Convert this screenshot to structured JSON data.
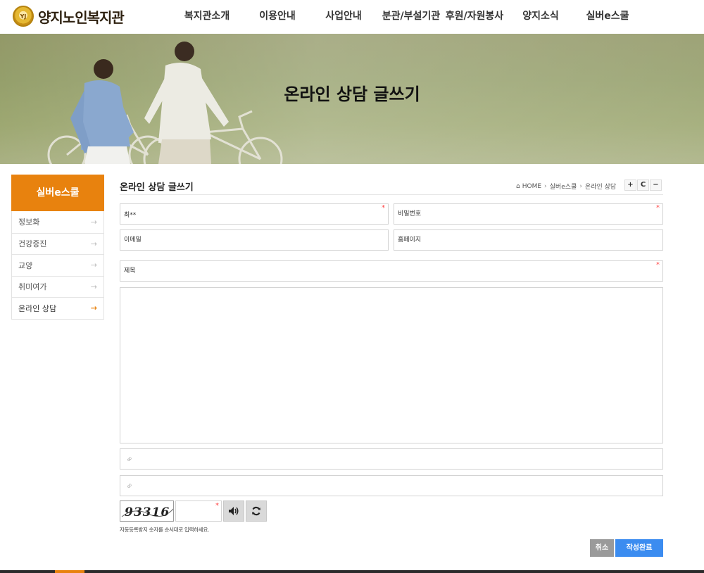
{
  "site": {
    "logo_text": "양지노인복지관",
    "emblem_text": "YJ"
  },
  "nav": {
    "items": [
      {
        "label": "복지관소개"
      },
      {
        "label": "이용안내"
      },
      {
        "label": "사업안내"
      },
      {
        "label": "분관/부설기관"
      },
      {
        "label": "후원/자원봉사"
      },
      {
        "label": "양지소식"
      },
      {
        "label": "실버e스쿨"
      }
    ]
  },
  "banner": {
    "title": "온라인 상담 글쓰기"
  },
  "sidebar": {
    "title": "실버e스쿨",
    "items": [
      {
        "label": "정보화",
        "active": false
      },
      {
        "label": "건강증진",
        "active": false
      },
      {
        "label": "교양",
        "active": false
      },
      {
        "label": "취미여가",
        "active": false
      },
      {
        "label": "온라인 상담",
        "active": true
      }
    ],
    "arrow": "→"
  },
  "content": {
    "title": "온라인 상담 글쓰기",
    "breadcrumb": [
      "HOME",
      "실버e스쿨",
      "온라인 상담"
    ],
    "breadcrumb_sep": "›",
    "tools": [
      "+",
      "C",
      "−"
    ]
  },
  "form": {
    "name_value": "최**",
    "password_placeholder": "비밀번호",
    "email_placeholder": "이메일",
    "homepage_placeholder": "홈페이지",
    "subject_placeholder": "제목",
    "content_value": "",
    "link1_value": "",
    "link2_value": "",
    "required_mark": "*",
    "link_icon": "link-icon",
    "captcha_text": "93316",
    "captcha_input_value": "",
    "captcha_help": "자동등록방지 숫자를 순서대로 입력하세요.",
    "audio_icon": "speaker-icon",
    "refresh_icon": "refresh-icon"
  },
  "buttons": {
    "cancel": "취소",
    "submit": "작성완료"
  },
  "colors": {
    "accent": "#e8820e",
    "submit": "#3b8cf0",
    "cancel": "#9a9a9a"
  }
}
